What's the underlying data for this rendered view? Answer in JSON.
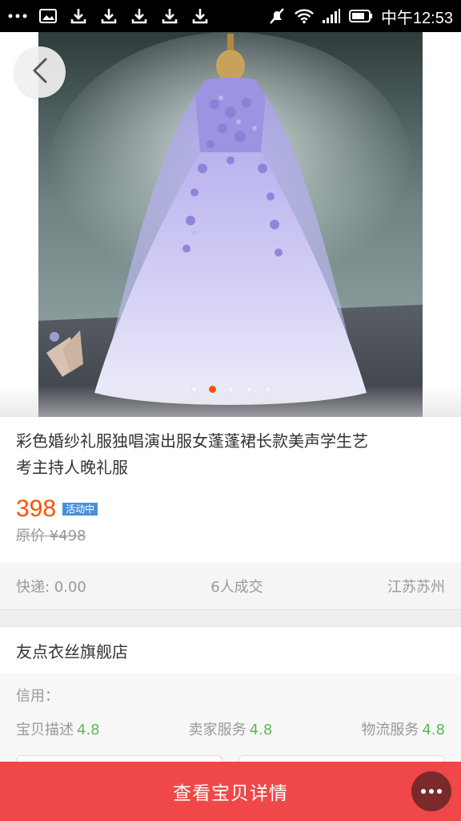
{
  "status_bar": {
    "time": "中午12:53",
    "left_icons": [
      "more-icon",
      "image-icon",
      "download-icon",
      "download-icon",
      "download-icon",
      "download-icon",
      "download-icon"
    ],
    "right_icons": [
      "mute-icon",
      "wifi-icon",
      "signal-icon",
      "battery-icon"
    ]
  },
  "gallery": {
    "image_count": 5,
    "active_index": 1
  },
  "product": {
    "title": "彩色婚纱礼服独唱演出服女蓬蓬裙长款美声学生艺考主持人晚礼服",
    "price": "398",
    "activity_badge": "活动中",
    "original_price": "原价 ¥498"
  },
  "meta": {
    "shipping": "快递: 0.00",
    "sales": "6人成交",
    "location": "江苏苏州"
  },
  "shop": {
    "name": "友点衣丝旗舰店",
    "credit_label": "信用：",
    "ratings": [
      {
        "label": "宝贝描述",
        "score": "4.8"
      },
      {
        "label": "卖家服务",
        "score": "4.8"
      },
      {
        "label": "物流服务",
        "score": "4.8"
      }
    ]
  },
  "bottom_bar": {
    "detail_label": "查看宝贝详情"
  },
  "colors": {
    "price": "#ff5000",
    "bottom_bar": "#f04848",
    "rating": "#5cb85c"
  }
}
